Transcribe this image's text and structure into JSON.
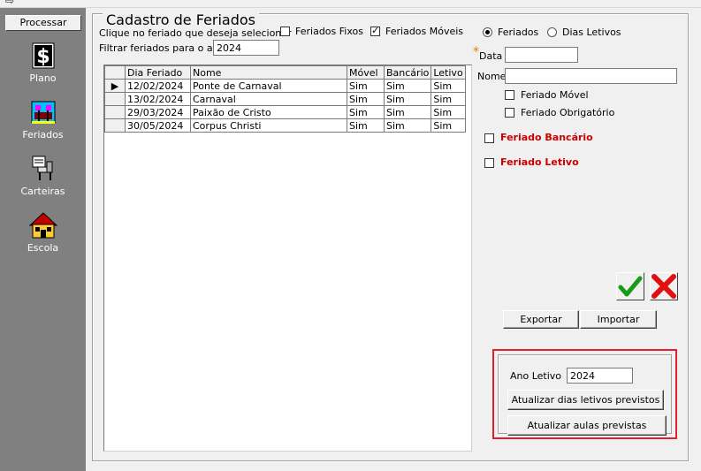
{
  "sidebar": {
    "process_label": "Processar",
    "items": [
      {
        "label": "Plano",
        "icon": "dollar-document-icon"
      },
      {
        "label": "Feriados",
        "icon": "calendar-flags-icon"
      },
      {
        "label": "Carteiras",
        "icon": "desk-chair-icon"
      },
      {
        "label": "Escola",
        "icon": "school-building-icon"
      }
    ]
  },
  "form": {
    "title": "Cadastro de Feriados",
    "select_hint": "Clique no feriado que deseja selecionar",
    "filter_label": "Filtrar feriados para o ano",
    "filter_year": "2024",
    "chk_fixos": "Feriados Fixos",
    "chk_moveis": "Feriados Móveis",
    "radio_feriados": "Feriados",
    "radio_dias_letivos": "Dias Letivos",
    "data_label": "Data",
    "data_required_mark": "*",
    "data_value": "",
    "nome_label": "Nome",
    "nome_value": "",
    "chk_feriado_movel": "Feriado Móvel",
    "chk_feriado_obrigatorio": "Feriado Obrigatório",
    "chk_feriado_bancario": "Feriado Bancário",
    "chk_feriado_letivo": "Feriado Letivo",
    "confirm_icon": "green-checkmark-icon",
    "cancel_icon": "red-x-icon",
    "export_label": "Exportar",
    "import_label": "Importar",
    "ano_letivo_label": "Ano Letivo",
    "ano_letivo_value": "2024",
    "btn_atualizar_dias": "Atualizar dias letivos previstos",
    "btn_atualizar_aulas": "Atualizar aulas previstas"
  },
  "grid": {
    "columns": [
      "Dia Feriado",
      "Nome",
      "Móvel",
      "Bancário",
      "Letivo"
    ],
    "rows": [
      {
        "date": "12/02/2024",
        "name": "Ponte de Carnaval",
        "movel": "Sim",
        "bancario": "Sim",
        "letivo": "Sim"
      },
      {
        "date": "13/02/2024",
        "name": "Carnaval",
        "movel": "Sim",
        "bancario": "Sim",
        "letivo": "Sim"
      },
      {
        "date": "29/03/2024",
        "name": "Paixão de Cristo",
        "movel": "Sim",
        "bancario": "Sim",
        "letivo": "Sim"
      },
      {
        "date": "30/05/2024",
        "name": "Corpus Christi",
        "movel": "Sim",
        "bancario": "Sim",
        "letivo": "Sim"
      }
    ]
  },
  "colors": {
    "sidebar_bg": "#808080",
    "highlight_border": "#e0202a",
    "red_label": "#cc0000"
  }
}
